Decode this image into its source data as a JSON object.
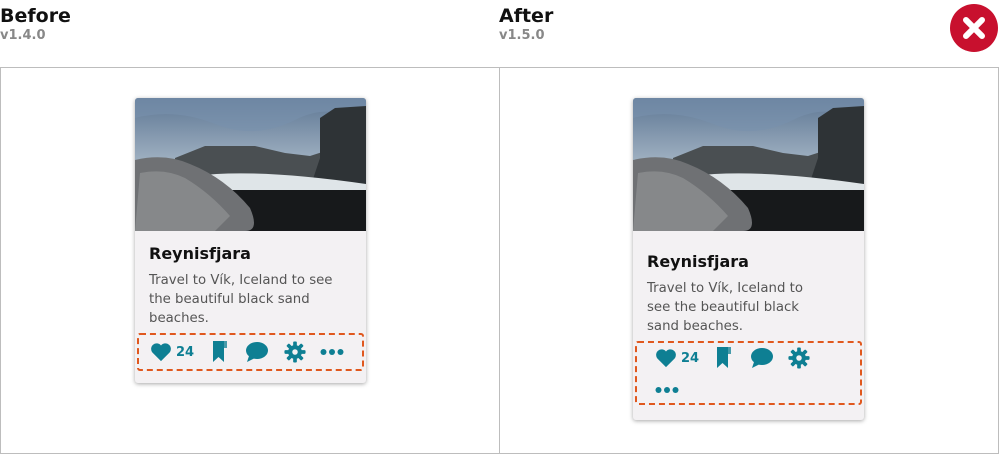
{
  "comparison": {
    "before": {
      "title": "Before",
      "version": "v1.4.0"
    },
    "after": {
      "title": "After",
      "version": "v1.5.0"
    },
    "status_icon": "close-icon",
    "status_color": "#c8102e",
    "highlight_color": "#e0581e"
  },
  "card": {
    "title": "Reynisfjara",
    "description": "Travel to Vík, Iceland to see the beautiful black sand beaches.",
    "image_alt": "black sand beach with rocky cliffs",
    "accent_color": "#0e7f93",
    "actions": {
      "like_icon": "heart-icon",
      "like_count": "24",
      "bookmark_icon": "bookmark-icon",
      "comment_icon": "comment-icon",
      "settings_icon": "gear-icon",
      "more_icon": "more-icon"
    }
  }
}
